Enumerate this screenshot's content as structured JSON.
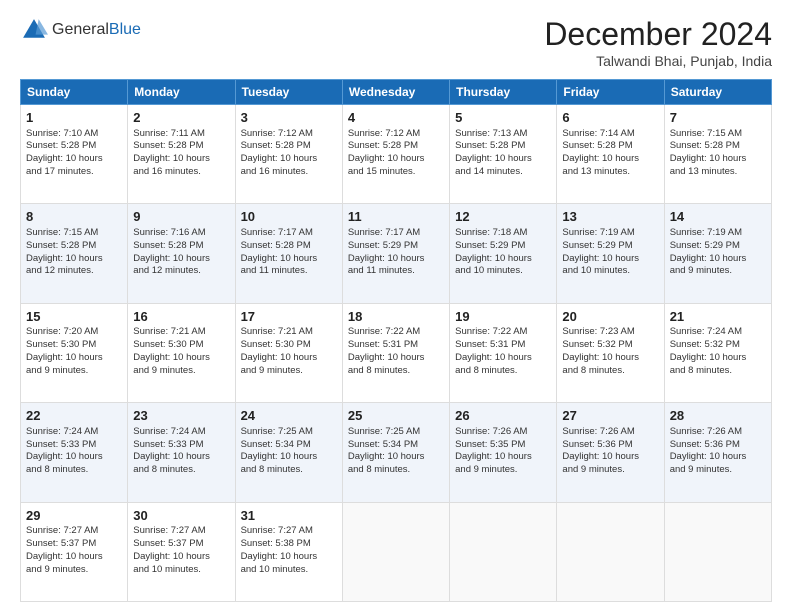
{
  "header": {
    "logo_general": "General",
    "logo_blue": "Blue",
    "month_title": "December 2024",
    "subtitle": "Talwandi Bhai, Punjab, India"
  },
  "days_of_week": [
    "Sunday",
    "Monday",
    "Tuesday",
    "Wednesday",
    "Thursday",
    "Friday",
    "Saturday"
  ],
  "weeks": [
    [
      {
        "day": 1,
        "sunrise": "7:10 AM",
        "sunset": "5:28 PM",
        "daylight": "10 hours and 17 minutes."
      },
      {
        "day": 2,
        "sunrise": "7:11 AM",
        "sunset": "5:28 PM",
        "daylight": "10 hours and 16 minutes."
      },
      {
        "day": 3,
        "sunrise": "7:12 AM",
        "sunset": "5:28 PM",
        "daylight": "10 hours and 16 minutes."
      },
      {
        "day": 4,
        "sunrise": "7:12 AM",
        "sunset": "5:28 PM",
        "daylight": "10 hours and 15 minutes."
      },
      {
        "day": 5,
        "sunrise": "7:13 AM",
        "sunset": "5:28 PM",
        "daylight": "10 hours and 14 minutes."
      },
      {
        "day": 6,
        "sunrise": "7:14 AM",
        "sunset": "5:28 PM",
        "daylight": "10 hours and 13 minutes."
      },
      {
        "day": 7,
        "sunrise": "7:15 AM",
        "sunset": "5:28 PM",
        "daylight": "10 hours and 13 minutes."
      }
    ],
    [
      {
        "day": 8,
        "sunrise": "7:15 AM",
        "sunset": "5:28 PM",
        "daylight": "10 hours and 12 minutes."
      },
      {
        "day": 9,
        "sunrise": "7:16 AM",
        "sunset": "5:28 PM",
        "daylight": "10 hours and 12 minutes."
      },
      {
        "day": 10,
        "sunrise": "7:17 AM",
        "sunset": "5:28 PM",
        "daylight": "10 hours and 11 minutes."
      },
      {
        "day": 11,
        "sunrise": "7:17 AM",
        "sunset": "5:29 PM",
        "daylight": "10 hours and 11 minutes."
      },
      {
        "day": 12,
        "sunrise": "7:18 AM",
        "sunset": "5:29 PM",
        "daylight": "10 hours and 10 minutes."
      },
      {
        "day": 13,
        "sunrise": "7:19 AM",
        "sunset": "5:29 PM",
        "daylight": "10 hours and 10 minutes."
      },
      {
        "day": 14,
        "sunrise": "7:19 AM",
        "sunset": "5:29 PM",
        "daylight": "10 hours and 9 minutes."
      }
    ],
    [
      {
        "day": 15,
        "sunrise": "7:20 AM",
        "sunset": "5:30 PM",
        "daylight": "10 hours and 9 minutes."
      },
      {
        "day": 16,
        "sunrise": "7:21 AM",
        "sunset": "5:30 PM",
        "daylight": "10 hours and 9 minutes."
      },
      {
        "day": 17,
        "sunrise": "7:21 AM",
        "sunset": "5:30 PM",
        "daylight": "10 hours and 9 minutes."
      },
      {
        "day": 18,
        "sunrise": "7:22 AM",
        "sunset": "5:31 PM",
        "daylight": "10 hours and 8 minutes."
      },
      {
        "day": 19,
        "sunrise": "7:22 AM",
        "sunset": "5:31 PM",
        "daylight": "10 hours and 8 minutes."
      },
      {
        "day": 20,
        "sunrise": "7:23 AM",
        "sunset": "5:32 PM",
        "daylight": "10 hours and 8 minutes."
      },
      {
        "day": 21,
        "sunrise": "7:24 AM",
        "sunset": "5:32 PM",
        "daylight": "10 hours and 8 minutes."
      }
    ],
    [
      {
        "day": 22,
        "sunrise": "7:24 AM",
        "sunset": "5:33 PM",
        "daylight": "10 hours and 8 minutes."
      },
      {
        "day": 23,
        "sunrise": "7:24 AM",
        "sunset": "5:33 PM",
        "daylight": "10 hours and 8 minutes."
      },
      {
        "day": 24,
        "sunrise": "7:25 AM",
        "sunset": "5:34 PM",
        "daylight": "10 hours and 8 minutes."
      },
      {
        "day": 25,
        "sunrise": "7:25 AM",
        "sunset": "5:34 PM",
        "daylight": "10 hours and 8 minutes."
      },
      {
        "day": 26,
        "sunrise": "7:26 AM",
        "sunset": "5:35 PM",
        "daylight": "10 hours and 9 minutes."
      },
      {
        "day": 27,
        "sunrise": "7:26 AM",
        "sunset": "5:36 PM",
        "daylight": "10 hours and 9 minutes."
      },
      {
        "day": 28,
        "sunrise": "7:26 AM",
        "sunset": "5:36 PM",
        "daylight": "10 hours and 9 minutes."
      }
    ],
    [
      {
        "day": 29,
        "sunrise": "7:27 AM",
        "sunset": "5:37 PM",
        "daylight": "10 hours and 9 minutes."
      },
      {
        "day": 30,
        "sunrise": "7:27 AM",
        "sunset": "5:37 PM",
        "daylight": "10 hours and 10 minutes."
      },
      {
        "day": 31,
        "sunrise": "7:27 AM",
        "sunset": "5:38 PM",
        "daylight": "10 hours and 10 minutes."
      },
      null,
      null,
      null,
      null
    ]
  ],
  "labels": {
    "sunrise": "Sunrise:",
    "sunset": "Sunset:",
    "daylight": "Daylight:"
  }
}
